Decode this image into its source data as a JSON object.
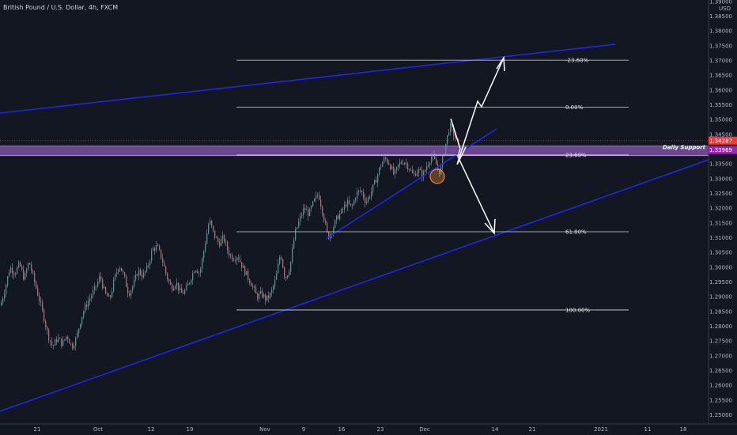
{
  "colors": {
    "background": "#131722",
    "axis_text": "#b2b5be",
    "up_candle": "#26a69a",
    "down_candle": "#ef5350",
    "channel": "#2424e8",
    "fib_line": "#d8d8d8",
    "support_zone": "#7b4fa3",
    "current_price": "#ef3b3b",
    "support_price": "#9c27b0",
    "projection": "#ffffff",
    "circle": "#e88a3a"
  },
  "chart_data": {
    "type": "candlestick",
    "title": "British Pound / U.S. Dollar, 4h, FXCM",
    "currency": "USD",
    "ylim": [
      1.2469,
      1.3905
    ],
    "y_ticks": [
      "1.39000",
      "1.38500",
      "1.38000",
      "1.37500",
      "1.37000",
      "1.36500",
      "1.36000",
      "1.35500",
      "1.35000",
      "1.34500",
      "1.34000",
      "1.33500",
      "1.33000",
      "1.32500",
      "1.32000",
      "1.31500",
      "1.31000",
      "1.30500",
      "1.30000",
      "1.29500",
      "1.29000",
      "1.28500",
      "1.28000",
      "1.27500",
      "1.27000",
      "1.26500",
      "1.26000",
      "1.25500",
      "1.25000"
    ],
    "x_ticks": [
      "21",
      "Oct",
      "12",
      "19",
      "Nov",
      "9",
      "16",
      "23",
      "Dec",
      "14",
      "21",
      "2021",
      "11",
      "18"
    ],
    "price_series": [
      [
        0,
        1.287
      ],
      [
        6,
        1.293
      ],
      [
        12,
        1.3
      ],
      [
        18,
        1.298
      ],
      [
        24,
        1.301
      ],
      [
        30,
        1.296
      ],
      [
        36,
        1.302
      ],
      [
        42,
        1.296
      ],
      [
        48,
        1.29
      ],
      [
        54,
        1.284
      ],
      [
        60,
        1.277
      ],
      [
        66,
        1.273
      ],
      [
        72,
        1.276
      ],
      [
        78,
        1.274
      ],
      [
        84,
        1.277
      ],
      [
        90,
        1.273
      ],
      [
        96,
        1.276
      ],
      [
        102,
        1.283
      ],
      [
        108,
        1.287
      ],
      [
        114,
        1.29
      ],
      [
        120,
        1.293
      ],
      [
        126,
        1.297
      ],
      [
        132,
        1.291
      ],
      [
        138,
        1.289
      ],
      [
        144,
        1.296
      ],
      [
        150,
        1.301
      ],
      [
        156,
        1.297
      ],
      [
        162,
        1.291
      ],
      [
        168,
        1.294
      ],
      [
        174,
        1.299
      ],
      [
        180,
        1.297
      ],
      [
        186,
        1.3
      ],
      [
        192,
        1.306
      ],
      [
        198,
        1.307
      ],
      [
        204,
        1.303
      ],
      [
        210,
        1.297
      ],
      [
        216,
        1.293
      ],
      [
        222,
        1.295
      ],
      [
        228,
        1.291
      ],
      [
        234,
        1.292
      ],
      [
        240,
        1.296
      ],
      [
        246,
        1.3
      ],
      [
        252,
        1.298
      ],
      [
        258,
        1.307
      ],
      [
        264,
        1.316
      ],
      [
        270,
        1.311
      ],
      [
        276,
        1.308
      ],
      [
        282,
        1.31
      ],
      [
        288,
        1.305
      ],
      [
        294,
        1.303
      ],
      [
        300,
        1.304
      ],
      [
        306,
        1.3
      ],
      [
        312,
        1.297
      ],
      [
        318,
        1.294
      ],
      [
        324,
        1.29
      ],
      [
        330,
        1.291
      ],
      [
        336,
        1.289
      ],
      [
        342,
        1.291
      ],
      [
        348,
        1.296
      ],
      [
        354,
        1.305
      ],
      [
        360,
        1.296
      ],
      [
        366,
        1.3
      ],
      [
        372,
        1.311
      ],
      [
        378,
        1.316
      ],
      [
        384,
        1.32
      ],
      [
        390,
        1.318
      ],
      [
        396,
        1.322
      ],
      [
        402,
        1.325
      ],
      [
        408,
        1.318
      ],
      [
        414,
        1.31
      ],
      [
        420,
        1.313
      ],
      [
        426,
        1.317
      ],
      [
        432,
        1.319
      ],
      [
        438,
        1.322
      ],
      [
        444,
        1.32
      ],
      [
        450,
        1.325
      ],
      [
        456,
        1.326
      ],
      [
        462,
        1.322
      ],
      [
        468,
        1.325
      ],
      [
        474,
        1.329
      ],
      [
        480,
        1.334
      ],
      [
        486,
        1.337
      ],
      [
        492,
        1.335
      ],
      [
        498,
        1.331
      ],
      [
        504,
        1.335
      ],
      [
        510,
        1.336
      ],
      [
        516,
        1.334
      ],
      [
        522,
        1.331
      ],
      [
        528,
        1.333
      ],
      [
        534,
        1.331
      ],
      [
        540,
        1.335
      ],
      [
        546,
        1.338
      ],
      [
        552,
        1.334
      ],
      [
        556,
        1.332
      ],
      [
        560,
        1.338
      ],
      [
        564,
        1.343
      ],
      [
        568,
        1.348
      ],
      [
        572,
        1.346
      ],
      [
        576,
        1.343
      ],
      [
        580,
        1.341
      ]
    ]
  },
  "annotations": {
    "fib_levels": [
      {
        "label": "-23.60%",
        "price": 1.3701
      },
      {
        "label": "0.00%",
        "price": 1.3542
      },
      {
        "label": "23.60%",
        "price": 1.338
      },
      {
        "label": "61.80%",
        "price": 1.312
      },
      {
        "label": "100.00%",
        "price": 1.2855
      }
    ],
    "support_label": "Daily Support",
    "support_zone": [
      1.3378,
      1.341
    ],
    "current_price": {
      "label": "1.34287",
      "value": 1.34287
    },
    "support_price": {
      "label": "1.33969",
      "value": 1.33969
    }
  }
}
